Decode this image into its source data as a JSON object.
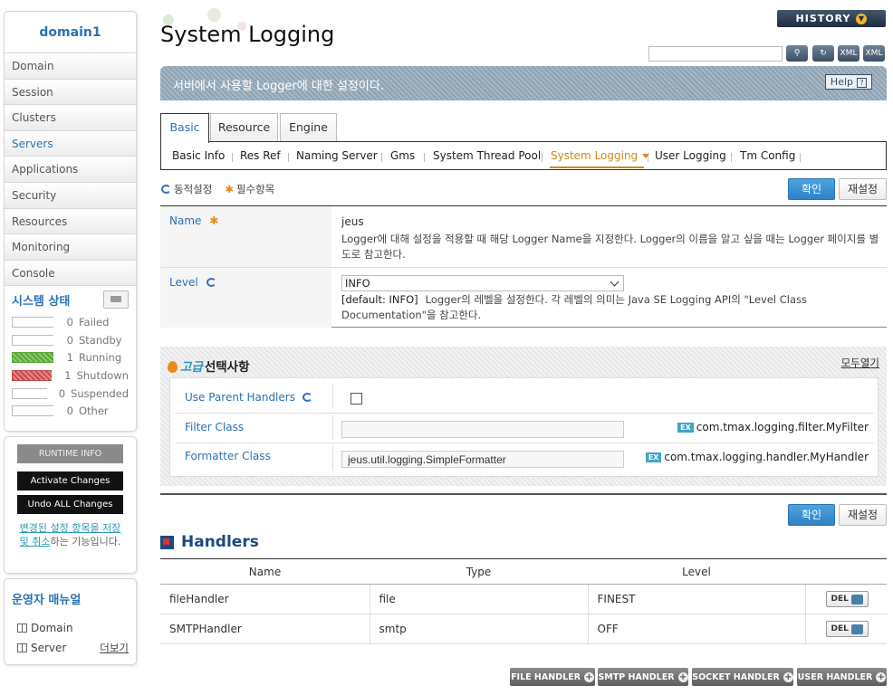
{
  "sidebar": {
    "domain_name": "domain1",
    "nav": [
      "Domain",
      "Session",
      "Clusters",
      "Servers",
      "Applications",
      "Security",
      "Resources",
      "Monitoring",
      "Console"
    ],
    "active_nav": "Servers",
    "system_status_title": "시스템 상태",
    "status": [
      {
        "count": "0",
        "label": "Failed",
        "state": "empty"
      },
      {
        "count": "0",
        "label": "Standby",
        "state": "empty"
      },
      {
        "count": "1",
        "label": "Running",
        "state": "running"
      },
      {
        "count": "1",
        "label": "Shutdown",
        "state": "shutdown"
      },
      {
        "count": "0",
        "label": "Suspended",
        "state": "empty"
      },
      {
        "count": "0",
        "label": "Other",
        "state": "empty"
      }
    ],
    "runtime_info": "RUNTIME INFO",
    "activate_changes": "Activate Changes",
    "undo_all_changes": "Undo ALL Changes",
    "runtime_note_link": "변경된 설정 항목을 저장 및 취소",
    "runtime_note_rest": "하는 기능입니다.",
    "manual_title": "운영자 매뉴얼",
    "manual_items": [
      "Domain",
      "Server"
    ],
    "more_link": "더보기"
  },
  "header": {
    "title": "System Logging",
    "history": "HISTORY",
    "search_value": "",
    "description": "서버에서 사용할 Logger에 대한 설정이다.",
    "help": "Help",
    "tool_icons": [
      "search-icon",
      "refresh-icon",
      "xml-export-icon",
      "xml-import-icon"
    ]
  },
  "tabs": {
    "main": [
      "Basic",
      "Resource",
      "Engine"
    ],
    "active_main": "Basic",
    "sub": [
      "Basic Info",
      "Res Ref",
      "Naming Server",
      "Gms",
      "System Thread Pool",
      "System Logging",
      "User Logging",
      "Tm Config"
    ],
    "active_sub": "System Logging"
  },
  "legend": {
    "dynamic": "동적설정",
    "required": "필수항목"
  },
  "buttons": {
    "confirm": "확인",
    "reset": "재설정"
  },
  "form": {
    "name_label": "Name",
    "name_value": "jeus",
    "name_desc": "Logger에 대해 설정을 적용할 때 해당 Logger Name을 지정한다. Logger의 이름을 알고 싶을 때는 Logger 페이지를 별도로 참고한다.",
    "level_label": "Level",
    "level_value": "INFO",
    "level_default": "[default: INFO]",
    "level_desc": "Logger의 레벨을 설정한다. 각 레벨의 의미는 Java SE Logging API의 \"Level Class Documentation\"을 참고한다."
  },
  "advanced": {
    "title_prefix": "고급",
    "title_rest": "선택사항",
    "expand_all": "모두열기",
    "use_parent_label": "Use Parent Handlers",
    "use_parent_checked": false,
    "filter_label": "Filter Class",
    "filter_value": "",
    "filter_example": "com.tmax.logging.filter.MyFilter",
    "formatter_label": "Formatter Class",
    "formatter_value": "jeus.util.logging.SimpleFormatter",
    "formatter_example": "com.tmax.logging.handler.MyHandler",
    "ex_badge": "EX"
  },
  "handlers": {
    "title": "Handlers",
    "columns": [
      "Name",
      "Type",
      "Level"
    ],
    "rows": [
      {
        "name": "fileHandler",
        "type": "file",
        "level": "FINEST"
      },
      {
        "name": "SMTPHandler",
        "type": "smtp",
        "level": "OFF"
      }
    ],
    "del_label": "DEL",
    "add_buttons": [
      "FILE HANDLER",
      "SMTP HANDLER",
      "SOCKET HANDLER",
      "USER HANDLER"
    ]
  }
}
